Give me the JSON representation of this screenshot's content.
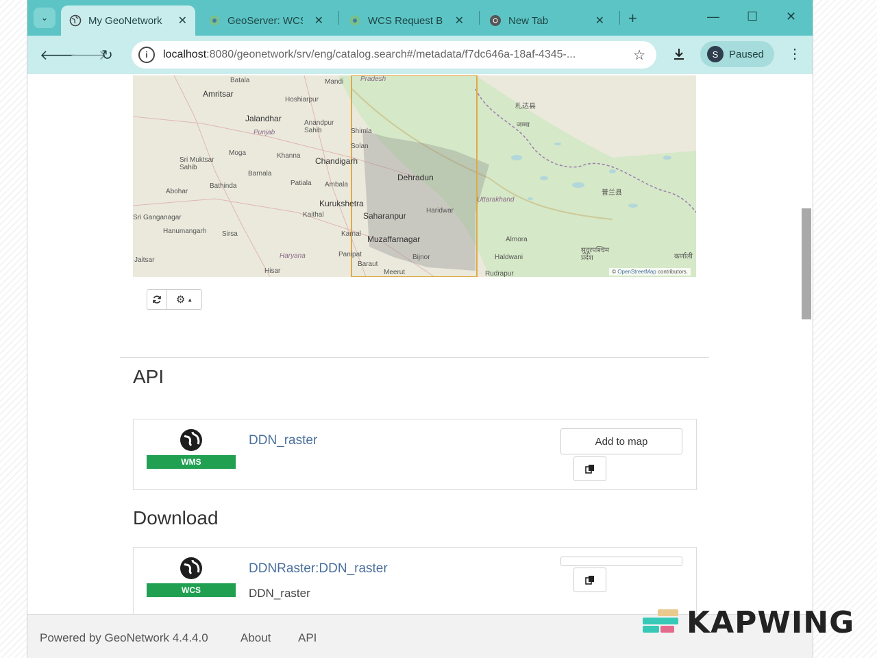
{
  "browser": {
    "tabs": [
      {
        "title": "My GeoNetwork",
        "active": true
      },
      {
        "title": "GeoServer: WCS",
        "active": false
      },
      {
        "title": "WCS Request Bu",
        "active": false
      },
      {
        "title": "New Tab",
        "active": false
      }
    ],
    "new_tab_symbol": "+",
    "url_host": "localhost",
    "url_rest": ":8080/geonetwork/srv/eng/catalog.search#/metadata/f7dc646a-18af-4345-...",
    "profile_initial": "S",
    "profile_status": "Paused"
  },
  "map": {
    "labels": [
      "Batala",
      "Mandi",
      "Pradesh",
      "Amritsar",
      "Hoshiarpur",
      "Jalandhar",
      "Anandpur Sahib",
      "Punjab",
      "Shimla",
      "Solan",
      "Moga",
      "Sri Muktsar Sahib",
      "Khanna",
      "Chandigarh",
      "Barnala",
      "Bathinda",
      "Patiala",
      "Ambala",
      "Dehradun",
      "Abohar",
      "Kurukshetra",
      "Haridwar",
      "Uttarakhand",
      "Sri Ganganagar",
      "Kaithal",
      "Saharanpur",
      "Hanumangarh",
      "Sirsa",
      "Karnal",
      "Muzaffarnagar",
      "Almora",
      "Jaitsar",
      "Haryana",
      "Panipat",
      "Bijnor",
      "Haldwani",
      "Hisar",
      "Baraut",
      "Meerut",
      "Rudrapur",
      "सुदूरपश्चिम प्रदेश",
      "कर्णाली",
      "札达县",
      "普兰县",
      "जम्मा"
    ],
    "attribution_prefix": "©",
    "attribution_link": "OpenStreetMap",
    "attribution_suffix": "contributors."
  },
  "map_tools": {
    "refresh_icon": "refresh-icon",
    "settings_icon": "gear-icon"
  },
  "sections": {
    "api_title": "API",
    "download_title": "Download"
  },
  "api_resource": {
    "protocol": "WMS",
    "name": "DDN_raster",
    "add_to_map": "Add to map"
  },
  "download_resource": {
    "protocol": "WCS",
    "name": "DDNRaster:DDN_raster",
    "description": "DDN_raster"
  },
  "footer": {
    "powered_by": "Powered by GeoNetwork 4.4.4.0",
    "about": "About",
    "api": "API"
  },
  "watermark": {
    "text": "KAPWING"
  },
  "colors": {
    "tabstrip": "#5cc4c4",
    "toolbar": "#c9ecec",
    "badge_green": "#21a052",
    "link": "#4a6f9c"
  }
}
